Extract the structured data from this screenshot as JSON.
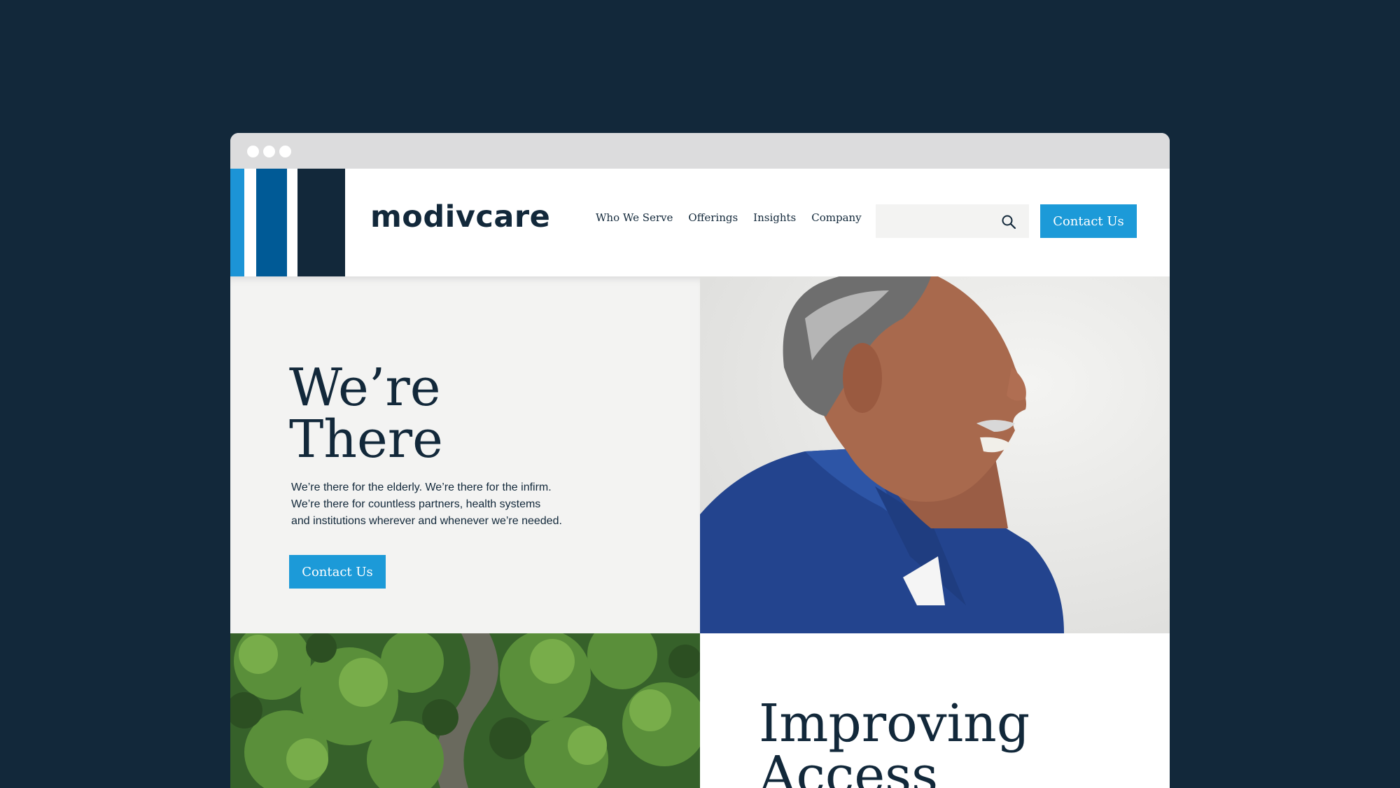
{
  "brand": {
    "logo_text": "modivcare",
    "colors": {
      "light_blue": "#1c94d6",
      "mid_blue": "#005a96",
      "navy": "#12283a",
      "button": "#1c9ad8"
    }
  },
  "nav": {
    "items": [
      {
        "label": "Who We Serve"
      },
      {
        "label": "Offerings"
      },
      {
        "label": "Insights"
      },
      {
        "label": "Company"
      }
    ]
  },
  "search": {
    "placeholder": "",
    "icon": "search-icon"
  },
  "header": {
    "cta_label": "Contact Us"
  },
  "hero": {
    "title_line1": "We’re",
    "title_line2": "There",
    "body_line1": "We’re there for the elderly. We’re there for the infirm.",
    "body_line2": "We’re there for countless partners, health systems",
    "body_line3": "and institutions wherever and whenever we’re needed.",
    "cta_label": "Contact Us"
  },
  "section2": {
    "title_line1": "Improving",
    "title_line2": "Access"
  }
}
